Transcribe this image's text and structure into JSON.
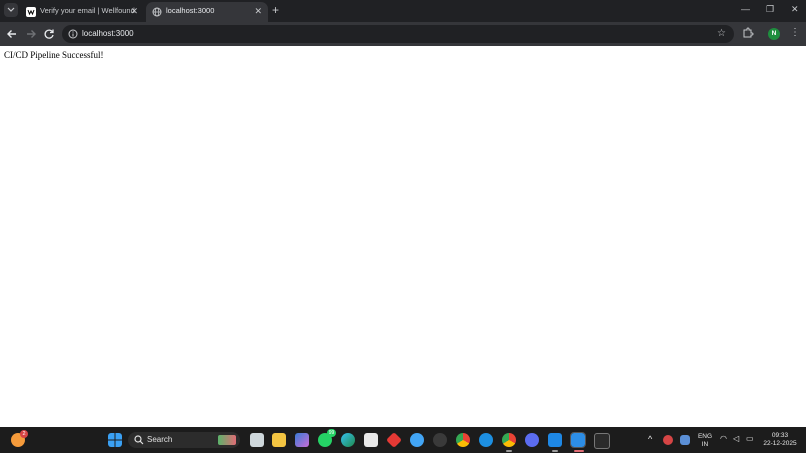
{
  "browser": {
    "tabs": [
      {
        "title": "Verify your email | Wellfound",
        "active": false
      },
      {
        "title": "localhost:3000",
        "active": true
      }
    ],
    "address": "localhost:3000",
    "profile_initial": "N"
  },
  "page": {
    "text": "CI/CD Pipeline Successful!"
  },
  "taskbar": {
    "search_label": "Search",
    "whatsapp_badge": "99",
    "widget_badge": "2",
    "language": "ENG",
    "region": "IN",
    "time": "09:33",
    "date": "22-12-2025"
  },
  "colors": {
    "chrome_dark": "#202124",
    "chrome_toolbar": "#35363a",
    "taskbar_bg": "#1c1c1c",
    "profile_green": "#1e8e3e"
  }
}
